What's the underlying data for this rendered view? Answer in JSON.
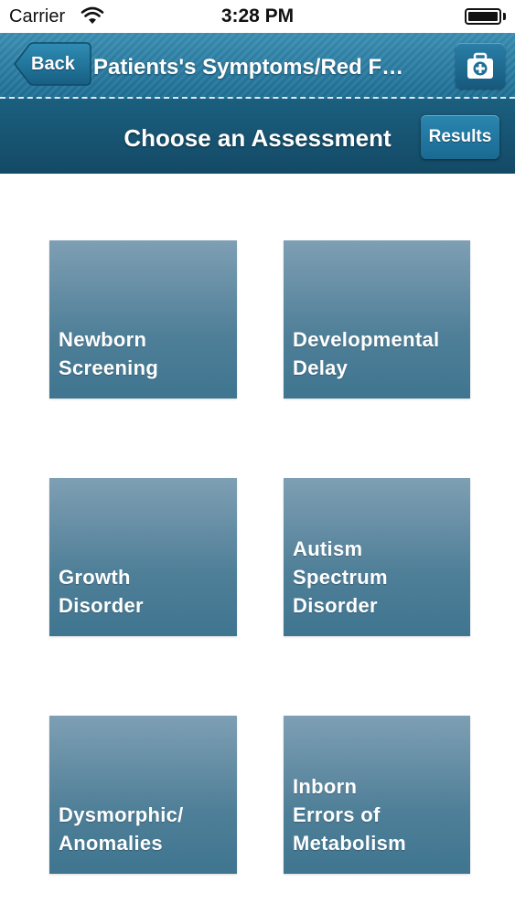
{
  "status_bar": {
    "carrier": "Carrier",
    "time": "3:28 PM"
  },
  "nav": {
    "back_label": "Back",
    "title": "Patients's Symptoms/Red F…",
    "kit_icon": "first-aid-kit-icon"
  },
  "sub_header": {
    "title": "Choose an Assessment",
    "results_label": "Results"
  },
  "tiles": [
    {
      "label": "Newborn\nScreening"
    },
    {
      "label": "Developmental\nDelay"
    },
    {
      "label": "Growth\nDisorder"
    },
    {
      "label": "Autism\nSpectrum\nDisorder"
    },
    {
      "label": "Dysmorphic/\nAnomalies"
    },
    {
      "label": "Inborn\nErrors of\nMetabolism"
    }
  ],
  "colors": {
    "nav_bar": "#2a7fa6",
    "sub_header": "#174f6b",
    "tile_top": "#7e9fb4",
    "tile_bottom": "#3f7590",
    "background": "#ffffff"
  }
}
